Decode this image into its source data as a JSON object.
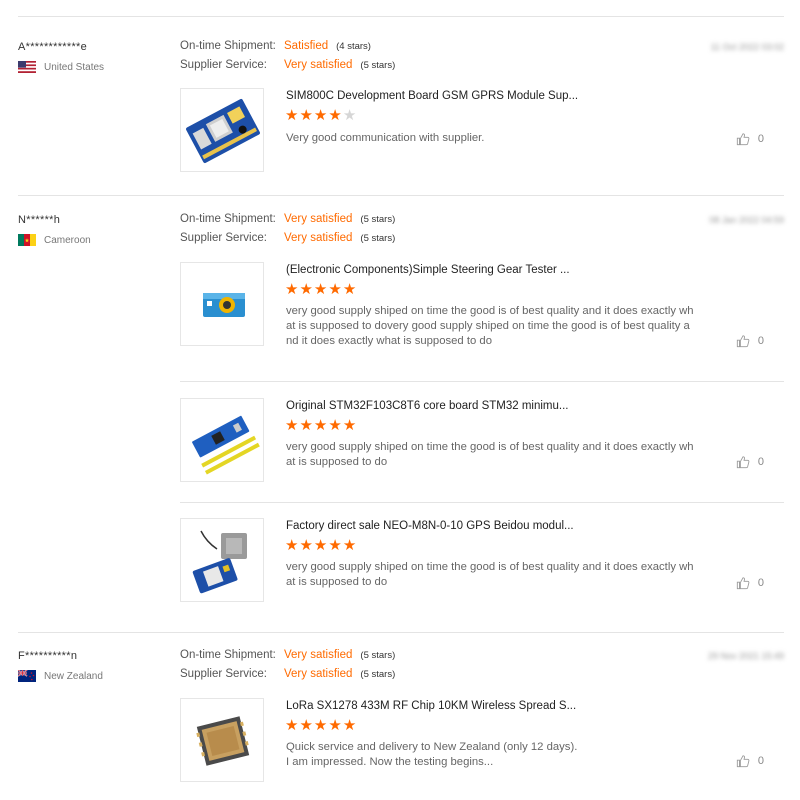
{
  "labels": {
    "ontime": "On-time Shipment:",
    "supplier": "Supplier Service:"
  },
  "reviews": [
    {
      "buyer": "A************e",
      "country": "United States",
      "flag": "us-flag",
      "date": "11 Oct 2022 03:02",
      "ontime_value": "Satisfied",
      "ontime_stars": "(4 stars)",
      "supplier_value": "Very satisfied",
      "supplier_stars": "(5 stars)",
      "products": [
        {
          "title": "SIM800C Development Board GSM GPRS Module Sup...",
          "rating": 4,
          "comment": "Very good communication with supplier.",
          "likes": "0",
          "image": "gsm-board-image"
        }
      ]
    },
    {
      "buyer": "N******h",
      "country": "Cameroon",
      "flag": "cameroon-flag",
      "date": "08 Jan 2022 04:59",
      "ontime_value": "Very satisfied",
      "ontime_stars": "(5 stars)",
      "supplier_value": "Very satisfied",
      "supplier_stars": "(5 stars)",
      "products": [
        {
          "title": "(Electronic Components)Simple Steering Gear Tester ...",
          "rating": 5,
          "comment": "very good supply shiped on time the good is of best quality and it does exactly what is supposed to dovery good supply shiped on time the good is of best quality and it does exactly what is supposed to do",
          "likes": "0",
          "image": "servo-tester-image"
        },
        {
          "title": "Original STM32F103C8T6 core board STM32 minimu...",
          "rating": 5,
          "comment": "very good supply shiped on time the good is of best quality and it does exactly what is supposed to do",
          "likes": "0",
          "image": "stm32-board-image"
        },
        {
          "title": "Factory direct sale NEO-M8N-0-10 GPS Beidou modul...",
          "rating": 5,
          "comment": "very good supply shiped on time the good is of best quality and it does exactly what is supposed to do",
          "likes": "0",
          "image": "gps-module-image"
        }
      ]
    },
    {
      "buyer": "F**********n",
      "country": "New Zealand",
      "flag": "nz-flag",
      "date": "29 Nov 2021 15:49",
      "ontime_value": "Very satisfied",
      "ontime_stars": "(5 stars)",
      "supplier_value": "Very satisfied",
      "supplier_stars": "(5 stars)",
      "products": [
        {
          "title": "LoRa SX1278 433M RF Chip 10KM Wireless Spread S...",
          "rating": 5,
          "comment": "Quick service and delivery to New Zealand (only 12 days).\nI am impressed. Now the testing begins...",
          "likes": "0",
          "image": "lora-module-image"
        }
      ]
    }
  ],
  "colors": {
    "accent": "#ff6a00",
    "star_empty": "#d6d6d6",
    "divider": "#e4e4e4"
  }
}
